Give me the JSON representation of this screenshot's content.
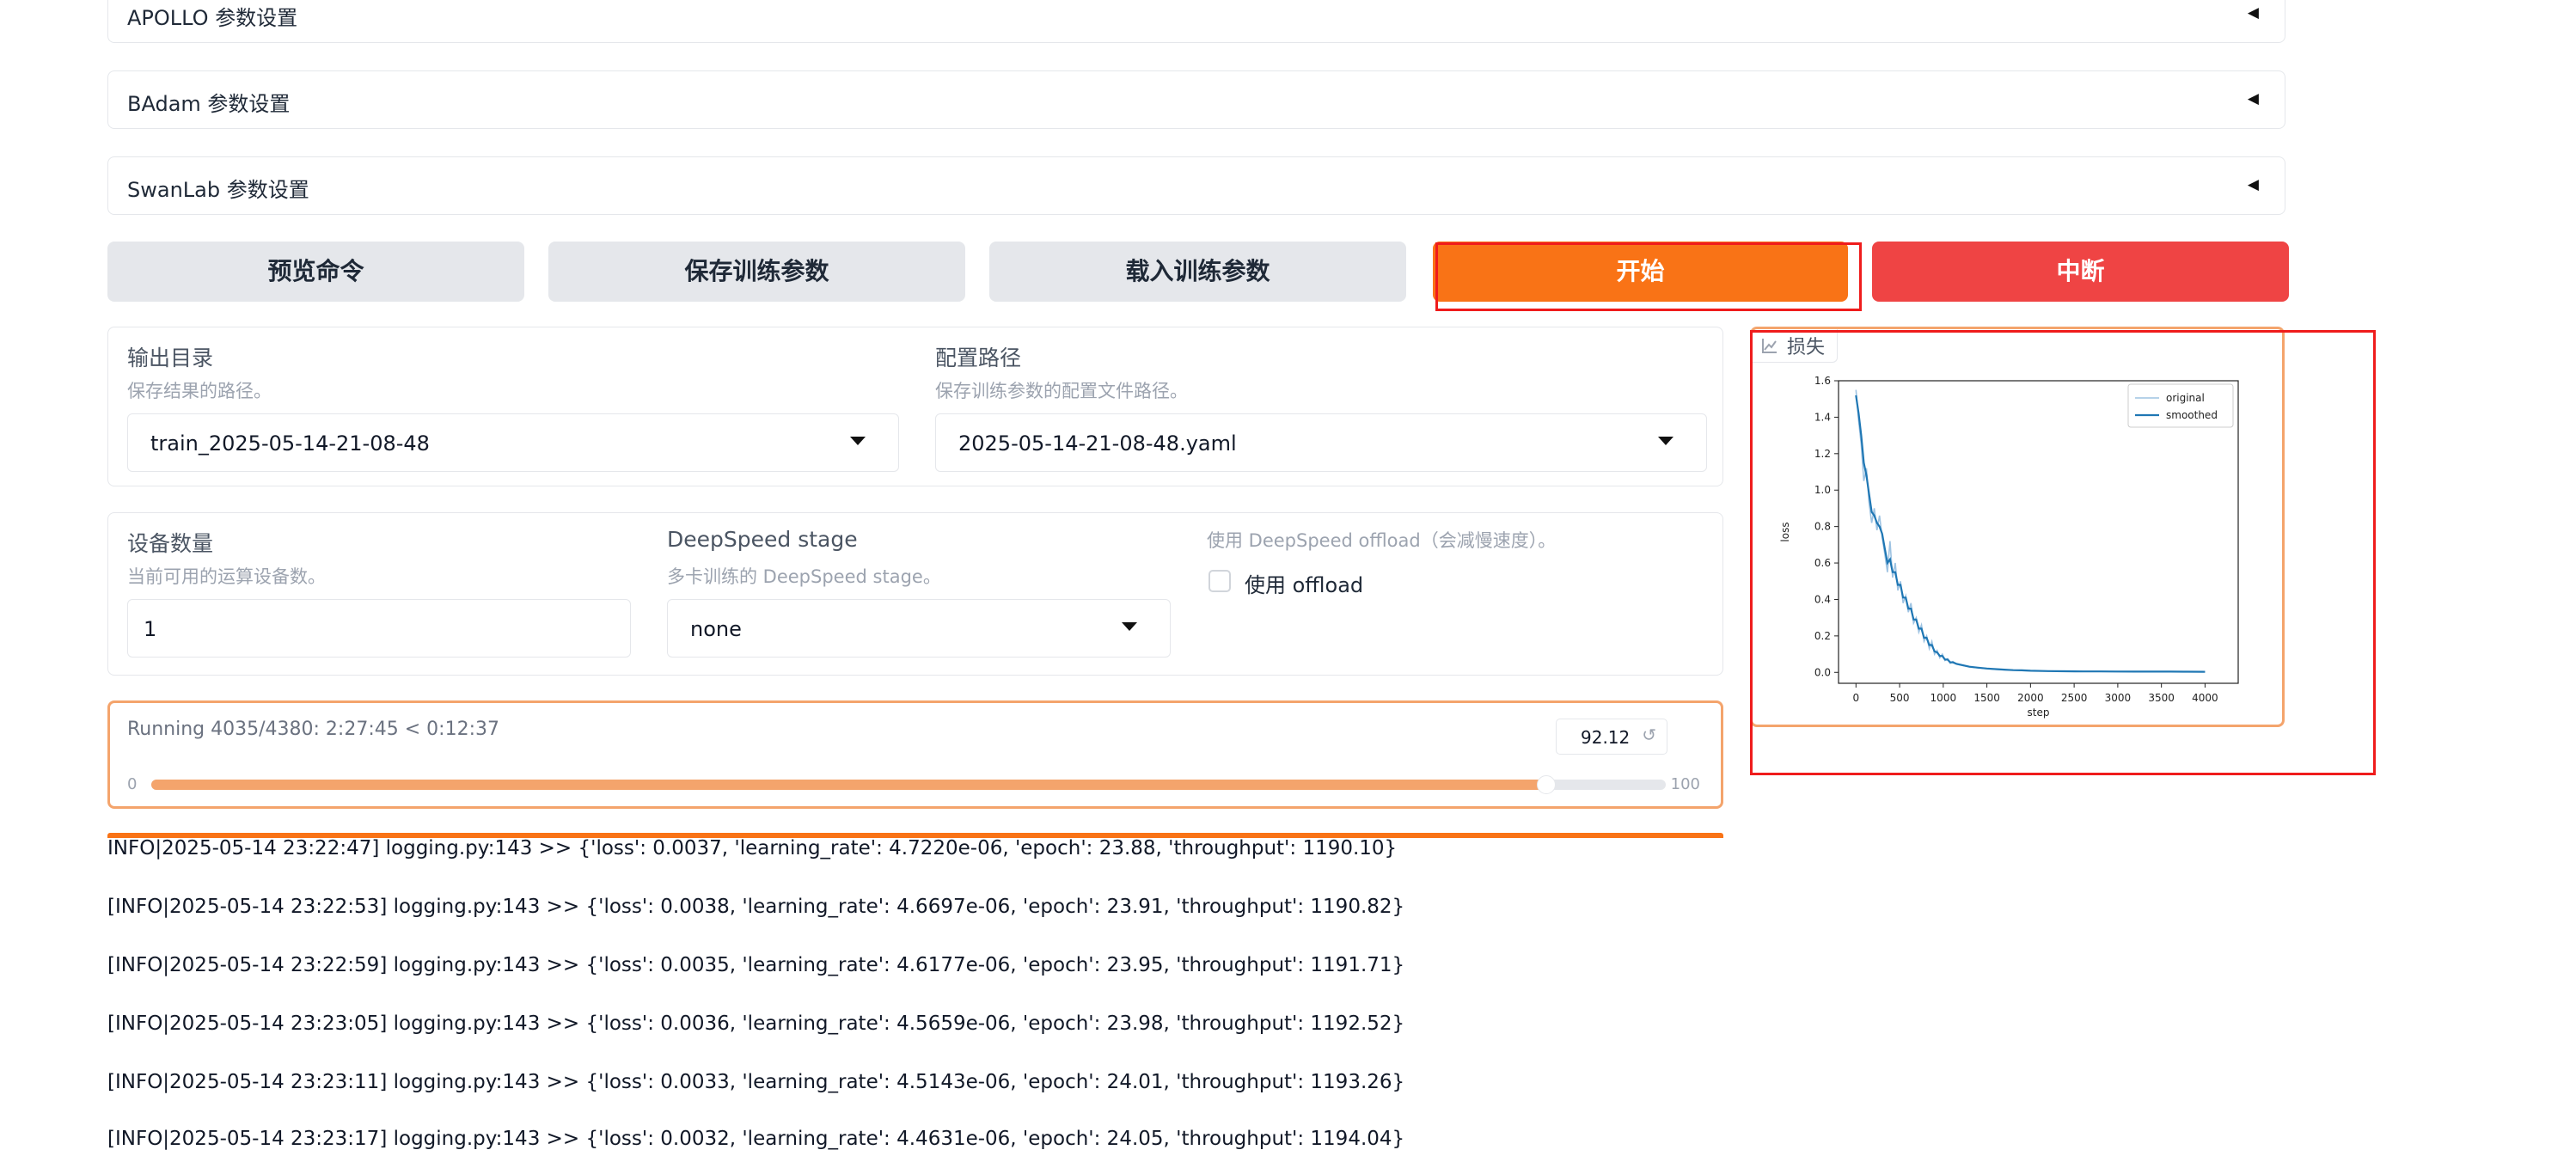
{
  "accordions": [
    {
      "label": "APOLLO 参数设置"
    },
    {
      "label": "BAdam 参数设置"
    },
    {
      "label": "SwanLab 参数设置"
    }
  ],
  "accordion_toggle_glyph": "◀",
  "buttons": {
    "preview": "预览命令",
    "save": "保存训练参数",
    "load": "载入训练参数",
    "start": "开始",
    "abort": "中断"
  },
  "output": {
    "output_dir_label": "输出目录",
    "output_dir_info": "保存结果的路径。",
    "output_dir_value": "train_2025-05-14-21-08-48",
    "config_path_label": "配置路径",
    "config_path_info": "保存训练参数的配置文件路径。",
    "config_path_value": "2025-05-14-21-08-48.yaml"
  },
  "device": {
    "device_count_label": "设备数量",
    "device_count_info": "当前可用的运算设备数。",
    "device_count_value": "1",
    "ds_stage_label": "DeepSpeed stage",
    "ds_stage_info": "多卡训练的 DeepSpeed stage。",
    "ds_stage_value": "none",
    "ds_offload_info": "使用 DeepSpeed offload（会减慢速度）。",
    "ds_offload_label": "使用 offload",
    "ds_offload_checked": false
  },
  "progress": {
    "status": "Running 4035/4380: 2:27:45 < 0:12:37",
    "value": "92.12",
    "min": "0",
    "max": "100",
    "fraction": 0.9212,
    "reset_icon": "↺",
    "color": "#f4a46c"
  },
  "logs": [
    "INFO|2025-05-14 23:22:47] logging.py:143 >> {'loss': 0.0037, 'learning_rate': 4.7220e-06, 'epoch': 23.88, 'throughput': 1190.10}",
    "[INFO|2025-05-14 23:22:53] logging.py:143 >> {'loss': 0.0038, 'learning_rate': 4.6697e-06, 'epoch': 23.91, 'throughput': 1190.82}",
    "[INFO|2025-05-14 23:22:59] logging.py:143 >> {'loss': 0.0035, 'learning_rate': 4.6177e-06, 'epoch': 23.95, 'throughput': 1191.71}",
    "[INFO|2025-05-14 23:23:05] logging.py:143 >> {'loss': 0.0036, 'learning_rate': 4.5659e-06, 'epoch': 23.98, 'throughput': 1192.52}",
    "[INFO|2025-05-14 23:23:11] logging.py:143 >> {'loss': 0.0033, 'learning_rate': 4.5143e-06, 'epoch': 24.01, 'throughput': 1193.26}",
    "[INFO|2025-05-14 23:23:17] logging.py:143 >> {'loss': 0.0032, 'learning_rate': 4.4631e-06, 'epoch': 24.05, 'throughput': 1194.04}"
  ],
  "loss_panel": {
    "label": "损失",
    "icon": "line-chart-icon"
  },
  "colors": {
    "accent_orange": "#f97316",
    "abort_red": "#ef4444",
    "highlight_red": "#ef1c1c",
    "series_original": "#9ec3e2",
    "series_smoothed": "#1f77b4"
  },
  "chart_data": {
    "type": "line",
    "xlabel": "step",
    "ylabel": "loss",
    "xlim": [
      -200,
      4380
    ],
    "ylim": [
      -0.06,
      1.6
    ],
    "xticks": [
      0,
      500,
      1000,
      1500,
      2000,
      2500,
      3000,
      3500,
      4000
    ],
    "yticks": [
      0.0,
      0.2,
      0.4,
      0.6,
      0.8,
      1.0,
      1.2,
      1.4,
      1.6
    ],
    "xtick_labels": [
      "0",
      "500",
      "1000",
      "1500",
      "2000",
      "2500",
      "3000",
      "3500",
      "4000"
    ],
    "ytick_labels": [
      "0.0",
      "0.2",
      "0.4",
      "0.6",
      "0.8",
      "1.0",
      "1.2",
      "1.4",
      "1.6"
    ],
    "legend_position": "top-right",
    "grid": false,
    "series": [
      {
        "name": "original",
        "x": [
          0,
          30,
          60,
          90,
          120,
          150,
          180,
          210,
          240,
          270,
          300,
          330,
          360,
          390,
          420,
          450,
          480,
          510,
          540,
          570,
          600,
          630,
          660,
          690,
          720,
          750,
          780,
          810,
          840,
          870,
          900,
          930,
          960,
          990,
          1020,
          1050,
          1080,
          1110,
          1150,
          1200,
          1250,
          1300,
          1400,
          1500,
          1600,
          1700,
          1800,
          1900,
          2000,
          2200,
          2400,
          2600,
          2800,
          3000,
          3200,
          3400,
          3600,
          3800,
          4000
        ],
        "y": [
          1.55,
          1.38,
          1.25,
          1.05,
          1.12,
          0.93,
          0.82,
          0.9,
          0.78,
          0.86,
          0.74,
          0.65,
          0.55,
          0.72,
          0.52,
          0.6,
          0.45,
          0.5,
          0.38,
          0.42,
          0.33,
          0.38,
          0.27,
          0.3,
          0.22,
          0.26,
          0.17,
          0.2,
          0.13,
          0.17,
          0.1,
          0.12,
          0.08,
          0.1,
          0.065,
          0.075,
          0.05,
          0.06,
          0.045,
          0.04,
          0.035,
          0.03,
          0.025,
          0.02,
          0.017,
          0.014,
          0.012,
          0.01,
          0.009,
          0.007,
          0.006,
          0.005,
          0.005,
          0.004,
          0.004,
          0.004,
          0.004,
          0.0035,
          0.0033
        ]
      },
      {
        "name": "smoothed",
        "x": [
          0,
          30,
          60,
          90,
          120,
          150,
          180,
          210,
          240,
          270,
          300,
          330,
          360,
          390,
          420,
          450,
          480,
          510,
          540,
          570,
          600,
          630,
          660,
          690,
          720,
          750,
          780,
          810,
          840,
          870,
          900,
          930,
          960,
          990,
          1020,
          1050,
          1080,
          1110,
          1150,
          1200,
          1250,
          1300,
          1400,
          1500,
          1600,
          1700,
          1800,
          1900,
          2000,
          2200,
          2400,
          2600,
          2800,
          3000,
          3200,
          3400,
          3600,
          3800,
          4000
        ],
        "y": [
          1.52,
          1.42,
          1.3,
          1.15,
          1.08,
          0.98,
          0.88,
          0.86,
          0.82,
          0.8,
          0.76,
          0.68,
          0.6,
          0.62,
          0.55,
          0.55,
          0.48,
          0.48,
          0.41,
          0.41,
          0.35,
          0.35,
          0.29,
          0.29,
          0.24,
          0.24,
          0.19,
          0.19,
          0.15,
          0.15,
          0.115,
          0.11,
          0.09,
          0.09,
          0.07,
          0.07,
          0.055,
          0.055,
          0.047,
          0.042,
          0.036,
          0.031,
          0.026,
          0.021,
          0.018,
          0.015,
          0.012,
          0.011,
          0.009,
          0.007,
          0.006,
          0.005,
          0.005,
          0.0045,
          0.004,
          0.004,
          0.004,
          0.0036,
          0.0034
        ]
      }
    ]
  }
}
